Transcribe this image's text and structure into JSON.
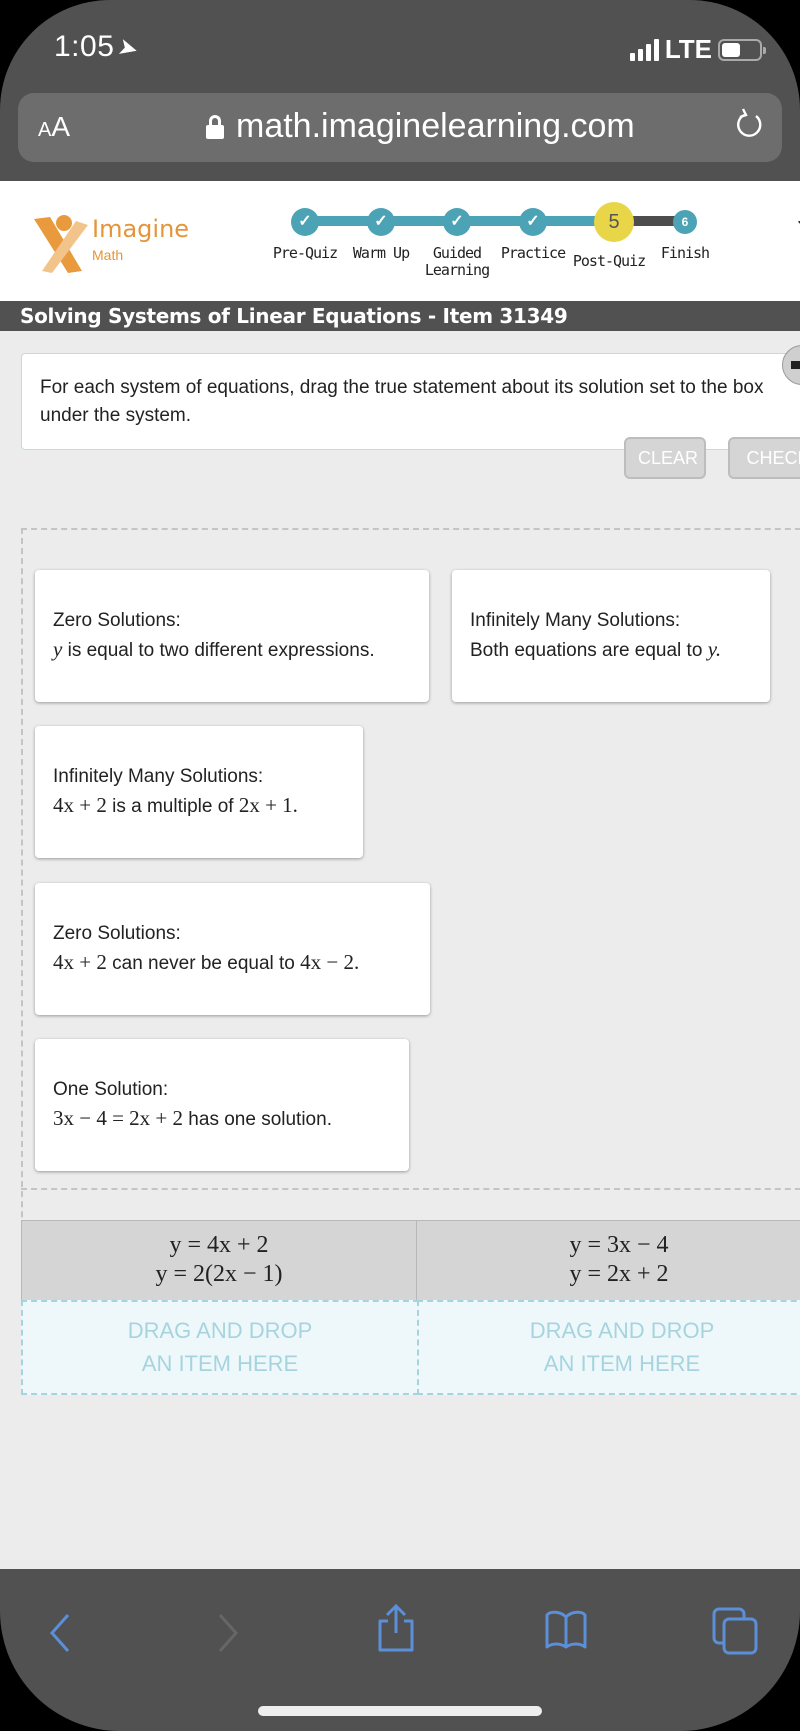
{
  "status_bar": {
    "time": "1:05",
    "network": "LTE"
  },
  "browser": {
    "text_size_label_small": "A",
    "text_size_label_large": "A",
    "url": "math.imaginelearning.com"
  },
  "app": {
    "logo_name": "Imagine",
    "logo_sub": "Math",
    "header_cut_text": "J",
    "progress_steps": [
      {
        "label_line1": "Pre-Quiz",
        "label_line2": "",
        "state": "complete",
        "marker": "✓"
      },
      {
        "label_line1": "Warm Up",
        "label_line2": "",
        "state": "complete",
        "marker": "✓"
      },
      {
        "label_line1": "Guided",
        "label_line2": "Learning",
        "state": "complete",
        "marker": "✓"
      },
      {
        "label_line1": "Practice",
        "label_line2": "",
        "state": "complete",
        "marker": "✓"
      },
      {
        "label_line1": "Post-Quiz",
        "label_line2": "",
        "state": "current",
        "marker": "5"
      },
      {
        "label_line1": "Finish",
        "label_line2": "",
        "state": "upcoming",
        "marker": "6"
      }
    ],
    "title": "Solving Systems of Linear Equations - Item 31349"
  },
  "question": {
    "instructions": "For each system of equations, drag the true statement about its solution set to the box under the system.",
    "buttons": {
      "clear": "CLEAR",
      "check": "CHECK"
    },
    "answer_cards": [
      {
        "heading": "Zero Solutions:",
        "math_pre": "y",
        "text": " is equal to two different expressions.",
        "math_post": ""
      },
      {
        "heading": "Infinitely Many Solutions:",
        "math_pre": "",
        "text": "Both equations are equal to ",
        "math_post": "y."
      },
      {
        "heading": "Infinitely Many Solutions:",
        "math_pre": "4x + 2",
        "text": " is a multiple of ",
        "math_post": "2x + 1."
      },
      {
        "heading": "Zero Solutions:",
        "math_pre": "4x + 2",
        "text": " can never be equal to ",
        "math_post": "4x − 2."
      },
      {
        "heading": "One Solution:",
        "math_pre": "3x − 4 = 2x + 2",
        "text": " has one solution.",
        "math_post": ""
      }
    ],
    "systems": [
      {
        "eq1": "y = 4x + 2",
        "eq2": "y = 2(2x − 1)",
        "drop_line1": "DRAG AND DROP",
        "drop_line2": "AN ITEM HERE"
      },
      {
        "eq1": "y = 3x − 4",
        "eq2": "y = 2x + 2",
        "drop_line1": "DRAG AND DROP",
        "drop_line2": "AN ITEM HERE"
      }
    ]
  },
  "colors": {
    "accent_teal": "#4ba3b5",
    "current_step_yellow": "#e8d548",
    "brand_orange": "#e4953a",
    "ios_blue": "#5b8fd9"
  },
  "toolbar_icons": [
    "back-icon",
    "forward-icon",
    "share-icon",
    "bookmarks-icon",
    "tabs-icon"
  ]
}
